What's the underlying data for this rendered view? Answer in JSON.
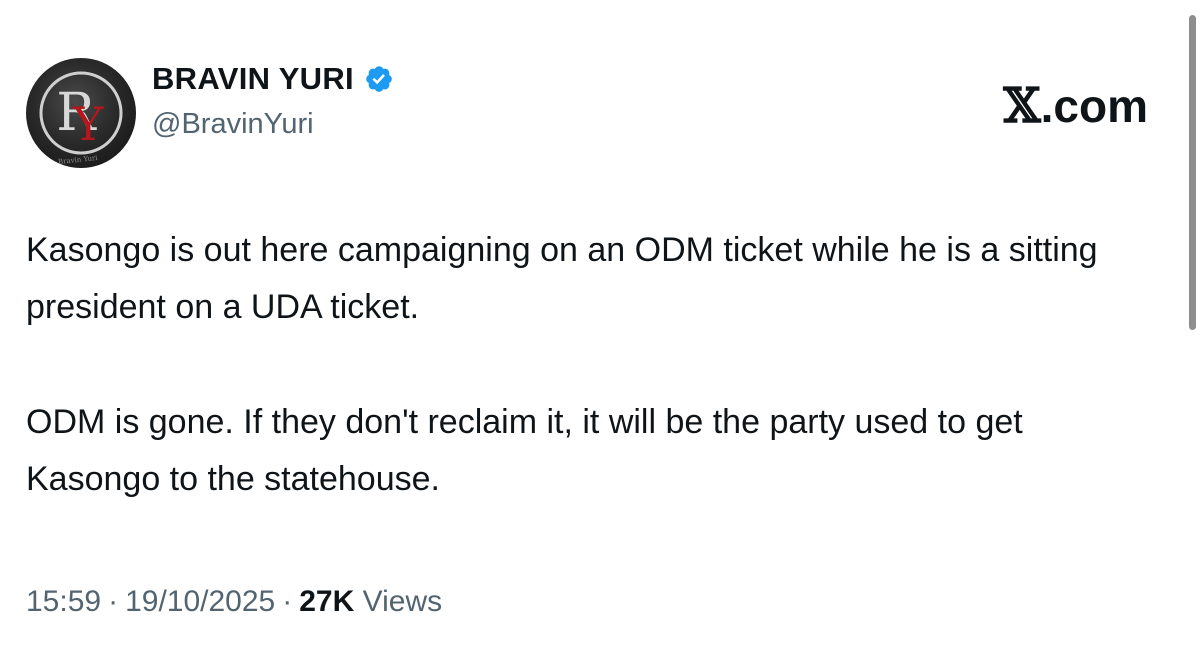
{
  "author": {
    "display_name": "BRAVIN YURI",
    "handle": "@BravinYuri",
    "verified_icon": "verified-badge-icon",
    "avatar": {
      "monogram": "RY",
      "caption": "Bravin Yuri"
    }
  },
  "brand": {
    "x_glyph": "𝕏",
    "suffix": ".com"
  },
  "tweet": {
    "paragraphs": [
      "Kasongo is out here campaigning on an ODM ticket while he is a sitting president on a UDA ticket.",
      "ODM is gone. If they don't reclaim it, it will be the party used to get Kasongo to the statehouse."
    ]
  },
  "meta": {
    "time": "15:59",
    "separator": "·",
    "date": "19/10/2025",
    "views_count": "27K",
    "views_label": "Views"
  },
  "colors": {
    "text": "#0f1419",
    "secondary": "#536471",
    "verified": "#1d9bf0",
    "avatar_red": "#b3161b"
  }
}
